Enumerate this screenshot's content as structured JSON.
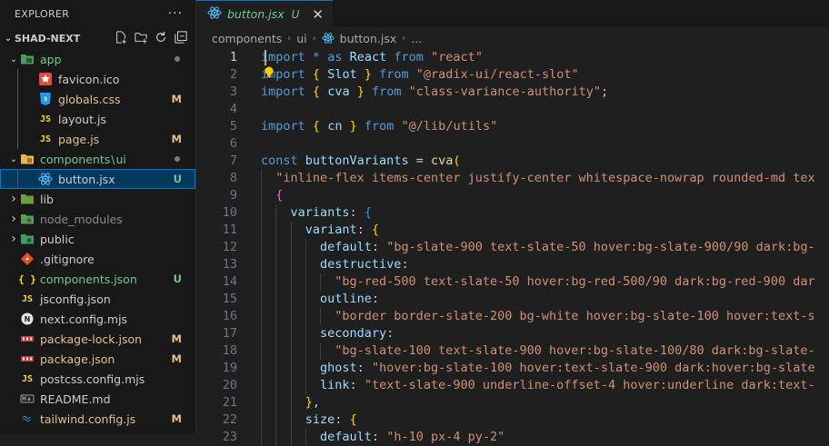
{
  "sidebar": {
    "header": "EXPLORER",
    "more_label": "···",
    "root": "SHAD-NEXT",
    "items": [
      {
        "name": "app",
        "icon": "folder-app-icon",
        "kind": "folder-open",
        "depth": 1,
        "status": "dot",
        "color": "#73c991"
      },
      {
        "name": "favicon.ico",
        "icon": "favicon-icon",
        "kind": "file",
        "depth": 2,
        "status": "",
        "color": "#cccccc"
      },
      {
        "name": "globals.css",
        "icon": "css-file-icon",
        "kind": "file",
        "depth": 2,
        "status": "M",
        "color": "#e2c08d"
      },
      {
        "name": "layout.js",
        "icon": "js-file-icon",
        "kind": "file",
        "depth": 2,
        "status": "",
        "color": "#cccccc"
      },
      {
        "name": "page.js",
        "icon": "js-file-icon",
        "kind": "file",
        "depth": 2,
        "status": "M",
        "color": "#e2c08d"
      },
      {
        "name": "components",
        "name2": "ui",
        "icon": "folder-components-icon",
        "kind": "folder-open",
        "depth": 1,
        "status": "dot",
        "color": "#73c991"
      },
      {
        "name": "button.jsx",
        "icon": "react-file-icon",
        "kind": "file",
        "depth": 2,
        "status": "U",
        "color": "#cccccc",
        "selected": true
      },
      {
        "name": "lib",
        "icon": "folder-lib-icon",
        "kind": "folder",
        "depth": 1,
        "status": "",
        "color": "#cccccc"
      },
      {
        "name": "node_modules",
        "icon": "folder-node-icon",
        "kind": "folder",
        "depth": 1,
        "status": "",
        "color": "#8c8c8c"
      },
      {
        "name": "public",
        "icon": "folder-public-icon",
        "kind": "folder",
        "depth": 1,
        "status": "",
        "color": "#cccccc"
      },
      {
        "name": ".gitignore",
        "icon": "git-file-icon",
        "kind": "file",
        "depth": 1,
        "status": "",
        "color": "#cccccc"
      },
      {
        "name": "components.json",
        "icon": "json-braces-icon",
        "kind": "file",
        "depth": 1,
        "status": "U",
        "color": "#73c991"
      },
      {
        "name": "jsconfig.json",
        "icon": "js-file-icon",
        "kind": "file",
        "depth": 1,
        "status": "",
        "color": "#cccccc"
      },
      {
        "name": "next.config.mjs",
        "icon": "next-file-icon",
        "kind": "file",
        "depth": 1,
        "status": "",
        "color": "#cccccc"
      },
      {
        "name": "package-lock.json",
        "icon": "npm-file-icon",
        "kind": "file",
        "depth": 1,
        "status": "M",
        "color": "#e2c08d"
      },
      {
        "name": "package.json",
        "icon": "npm-file-icon",
        "kind": "file",
        "depth": 1,
        "status": "M",
        "color": "#e2c08d"
      },
      {
        "name": "postcss.config.mjs",
        "icon": "js-file-icon",
        "kind": "file",
        "depth": 1,
        "status": "",
        "color": "#cccccc"
      },
      {
        "name": "README.md",
        "icon": "markdown-file-icon",
        "kind": "file",
        "depth": 1,
        "status": "",
        "color": "#cccccc"
      },
      {
        "name": "tailwind.config.js",
        "icon": "tailwind-file-icon",
        "kind": "file",
        "depth": 1,
        "status": "M",
        "color": "#e2c08d"
      }
    ]
  },
  "tab": {
    "name": "button.jsx",
    "status": "U",
    "close": "✕"
  },
  "breadcrumb": {
    "parts": [
      "components",
      "ui",
      "button.jsx",
      "..."
    ]
  },
  "colors": {
    "accent": "#0078d4",
    "modified": "#e2c08d",
    "untracked": "#73c991"
  },
  "code": {
    "active_line": 1,
    "lines": [
      [
        [
          "k",
          "import"
        ],
        [
          "p",
          " "
        ],
        [
          "k",
          "*"
        ],
        [
          "p",
          " "
        ],
        [
          "k",
          "as"
        ],
        [
          "p",
          " "
        ],
        [
          "v",
          "React"
        ],
        [
          "p",
          " "
        ],
        [
          "k",
          "from"
        ],
        [
          "p",
          " "
        ],
        [
          "s",
          "\"react\""
        ]
      ],
      [
        [
          "k",
          "import"
        ],
        [
          "p",
          " "
        ],
        [
          "b1",
          "{"
        ],
        [
          "p",
          " "
        ],
        [
          "v",
          "Slot"
        ],
        [
          "p",
          " "
        ],
        [
          "b1",
          "}"
        ],
        [
          "p",
          " "
        ],
        [
          "k",
          "from"
        ],
        [
          "p",
          " "
        ],
        [
          "s",
          "\"@radix-ui/react-slot\""
        ]
      ],
      [
        [
          "k",
          "import"
        ],
        [
          "p",
          " "
        ],
        [
          "b1",
          "{"
        ],
        [
          "p",
          " "
        ],
        [
          "v",
          "cva"
        ],
        [
          "p",
          " "
        ],
        [
          "b1",
          "}"
        ],
        [
          "p",
          " "
        ],
        [
          "k",
          "from"
        ],
        [
          "p",
          " "
        ],
        [
          "s",
          "\"class-variance-authority\""
        ],
        [
          "p",
          ";"
        ]
      ],
      [],
      [
        [
          "k",
          "import"
        ],
        [
          "p",
          " "
        ],
        [
          "b1",
          "{"
        ],
        [
          "p",
          " "
        ],
        [
          "v",
          "cn"
        ],
        [
          "p",
          " "
        ],
        [
          "b1",
          "}"
        ],
        [
          "p",
          " "
        ],
        [
          "k",
          "from"
        ],
        [
          "p",
          " "
        ],
        [
          "s",
          "\"@/lib/utils\""
        ]
      ],
      [],
      [
        [
          "k",
          "const"
        ],
        [
          "p",
          " "
        ],
        [
          "v",
          "buttonVariants"
        ],
        [
          "p",
          " = "
        ],
        [
          "fn",
          "cva"
        ],
        [
          "b1",
          "("
        ]
      ],
      [
        [
          "p",
          "  "
        ],
        [
          "s",
          "\"inline-flex items-center justify-center whitespace-nowrap rounded-md tex"
        ]
      ],
      [
        [
          "p",
          "  "
        ],
        [
          "b2",
          "{"
        ]
      ],
      [
        [
          "p",
          "    "
        ],
        [
          "prop",
          "variants"
        ],
        [
          "p",
          ": "
        ],
        [
          "b3",
          "{"
        ]
      ],
      [
        [
          "p",
          "      "
        ],
        [
          "prop",
          "variant"
        ],
        [
          "p",
          ": "
        ],
        [
          "b1",
          "{"
        ]
      ],
      [
        [
          "p",
          "        "
        ],
        [
          "prop",
          "default"
        ],
        [
          "p",
          ": "
        ],
        [
          "s",
          "\"bg-slate-900 text-slate-50 hover:bg-slate-900/90 dark:bg-"
        ]
      ],
      [
        [
          "p",
          "        "
        ],
        [
          "prop",
          "destructive"
        ],
        [
          "p",
          ":"
        ]
      ],
      [
        [
          "p",
          "          "
        ],
        [
          "s",
          "\"bg-red-500 text-slate-50 hover:bg-red-500/90 dark:bg-red-900 dar"
        ]
      ],
      [
        [
          "p",
          "        "
        ],
        [
          "prop",
          "outline"
        ],
        [
          "p",
          ":"
        ]
      ],
      [
        [
          "p",
          "          "
        ],
        [
          "s",
          "\"border border-slate-200 bg-white hover:bg-slate-100 hover:text-s"
        ]
      ],
      [
        [
          "p",
          "        "
        ],
        [
          "prop",
          "secondary"
        ],
        [
          "p",
          ":"
        ]
      ],
      [
        [
          "p",
          "          "
        ],
        [
          "s",
          "\"bg-slate-100 text-slate-900 hover:bg-slate-100/80 dark:bg-slate-"
        ]
      ],
      [
        [
          "p",
          "        "
        ],
        [
          "prop",
          "ghost"
        ],
        [
          "p",
          ": "
        ],
        [
          "s",
          "\"hover:bg-slate-100 hover:text-slate-900 dark:hover:bg-slate"
        ]
      ],
      [
        [
          "p",
          "        "
        ],
        [
          "prop",
          "link"
        ],
        [
          "p",
          ": "
        ],
        [
          "s",
          "\"text-slate-900 underline-offset-4 hover:underline dark:text-"
        ]
      ],
      [
        [
          "p",
          "      "
        ],
        [
          "b1",
          "}"
        ],
        [
          "p",
          ","
        ]
      ],
      [
        [
          "p",
          "      "
        ],
        [
          "prop",
          "size"
        ],
        [
          "p",
          ": "
        ],
        [
          "b1",
          "{"
        ]
      ],
      [
        [
          "p",
          "        "
        ],
        [
          "prop",
          "default"
        ],
        [
          "p",
          ": "
        ],
        [
          "s",
          "\"h-10 px-4 py-2\""
        ]
      ]
    ]
  }
}
